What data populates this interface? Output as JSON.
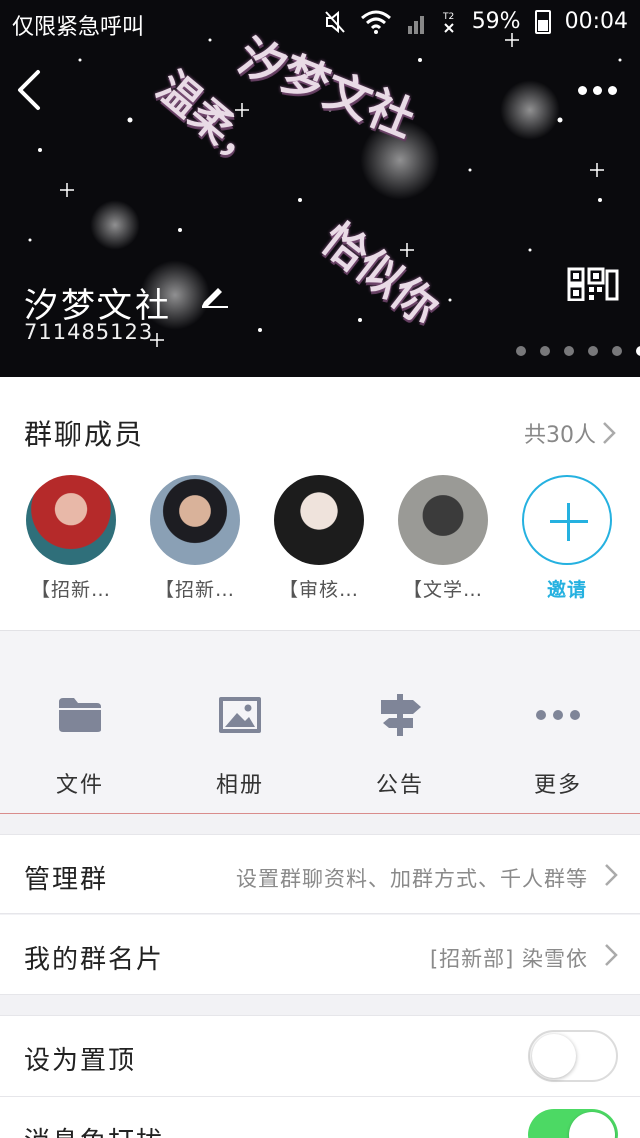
{
  "status_bar": {
    "carrier": "仅限紧急呼叫",
    "battery": "59%",
    "time": "00:04"
  },
  "header": {
    "group_name": "汐梦文社",
    "group_id": "711485123",
    "banner_text": [
      "汐梦文社",
      "温柔，",
      "恰似你"
    ],
    "banner_page_count": 6,
    "banner_active_page": 6
  },
  "members": {
    "title": "群聊成员",
    "count": "共30人",
    "list": [
      {
        "name": "【招新…"
      },
      {
        "name": "【招新…"
      },
      {
        "name": "【审核…"
      },
      {
        "name": "【文学…"
      }
    ],
    "invite_label": "邀请"
  },
  "actions": [
    {
      "label": "文件",
      "icon": "folder-icon"
    },
    {
      "label": "相册",
      "icon": "image-icon"
    },
    {
      "label": "公告",
      "icon": "signpost-icon"
    },
    {
      "label": "更多",
      "icon": "more-horizontal-icon"
    }
  ],
  "rows": {
    "manage": {
      "label": "管理群",
      "value": "设置群聊资料、加群方式、千人群等"
    },
    "card": {
      "label": "我的群名片",
      "value": "[招新部] 染雪依"
    },
    "pin": {
      "label": "设为置顶",
      "enabled": false
    },
    "dnd": {
      "label": "消息免打扰",
      "enabled": true
    }
  },
  "colors": {
    "accent": "#25b1e0",
    "toggle_on": "#4cd964"
  }
}
